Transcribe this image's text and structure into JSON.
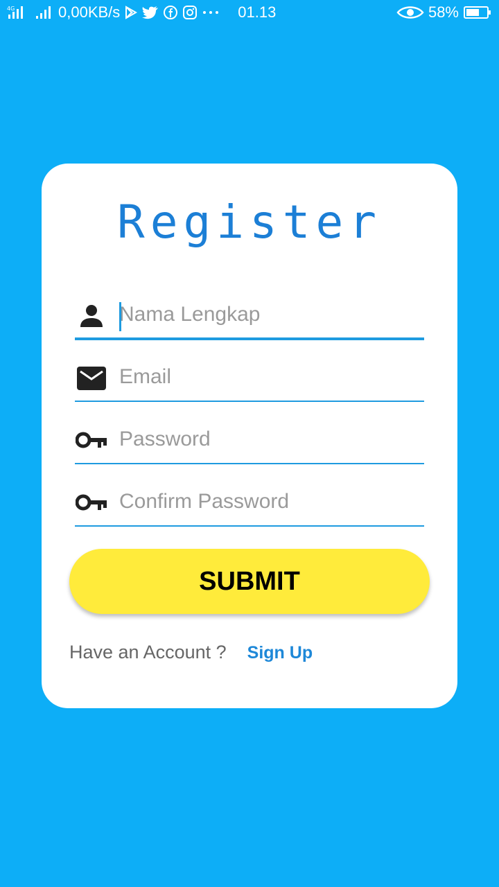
{
  "status_bar": {
    "network_label": "4G",
    "speed": "0,00KB/s",
    "time": "01.13",
    "battery": "58%",
    "icons": [
      "signal-icon",
      "signal-icon",
      "play-store-icon",
      "twitter-icon",
      "facebook-icon",
      "instagram-icon",
      "more-icon",
      "eye-icon",
      "battery-icon"
    ]
  },
  "form": {
    "title": "Register",
    "fields": [
      {
        "icon": "person-icon",
        "placeholder": "Nama Lengkap",
        "value": ""
      },
      {
        "icon": "mail-icon",
        "placeholder": "Email",
        "value": ""
      },
      {
        "icon": "key-icon",
        "placeholder": "Password",
        "value": ""
      },
      {
        "icon": "key-icon",
        "placeholder": "Confirm Password",
        "value": ""
      }
    ],
    "submit_label": "SUBMIT",
    "account_text": "Have an Account ?",
    "signup_label": "Sign Up"
  },
  "colors": {
    "background": "#0DAEF7",
    "title": "#1C7FD6",
    "accent": "#1E9BE0",
    "button": "#FFEB3B",
    "link": "#1E88D8"
  }
}
